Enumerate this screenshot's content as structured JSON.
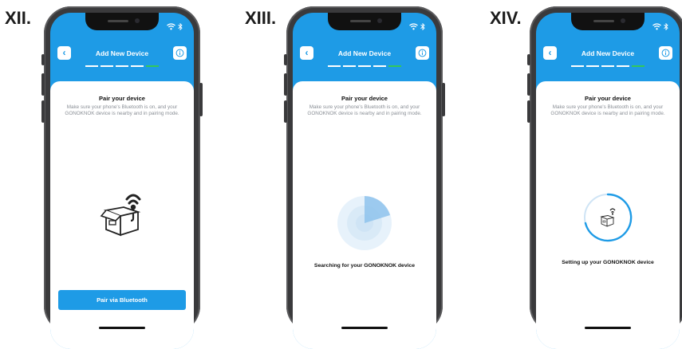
{
  "steps": [
    {
      "number": "XII.",
      "header_title": "Add New Device",
      "card_title": "Pair your device",
      "card_desc": "Make sure your phone's Bluetooth is on, and your GONOKNOK device is nearby and in pairing mode.",
      "status_text": "",
      "button_label": "Pair via Bluetooth",
      "illustration": "device-box-icon"
    },
    {
      "number": "XIII.",
      "header_title": "Add New Device",
      "card_title": "Pair your device",
      "card_desc": "Make sure your phone's Bluetooth is on, and your GONOKNOK device is nearby and in pairing mode.",
      "status_text": "Searching for your GONOKNOK device",
      "button_label": "",
      "illustration": "radar-scan-icon"
    },
    {
      "number": "XIV.",
      "header_title": "Add New Device",
      "card_title": "Pair your device",
      "card_desc": "Make sure your phone's Bluetooth is on, and your GONOKNOK device is nearby and in pairing mode.",
      "status_text": "Setting up your GONOKNOK device",
      "button_label": "",
      "illustration": "setup-progress-icon"
    }
  ],
  "colors": {
    "brand_blue": "#1e9be6",
    "progress_active": "#34c759",
    "phone_frame": "#3a3a3c"
  },
  "icons": [
    "back-arrow-icon",
    "info-icon",
    "wifi-icon",
    "bluetooth-icon"
  ]
}
